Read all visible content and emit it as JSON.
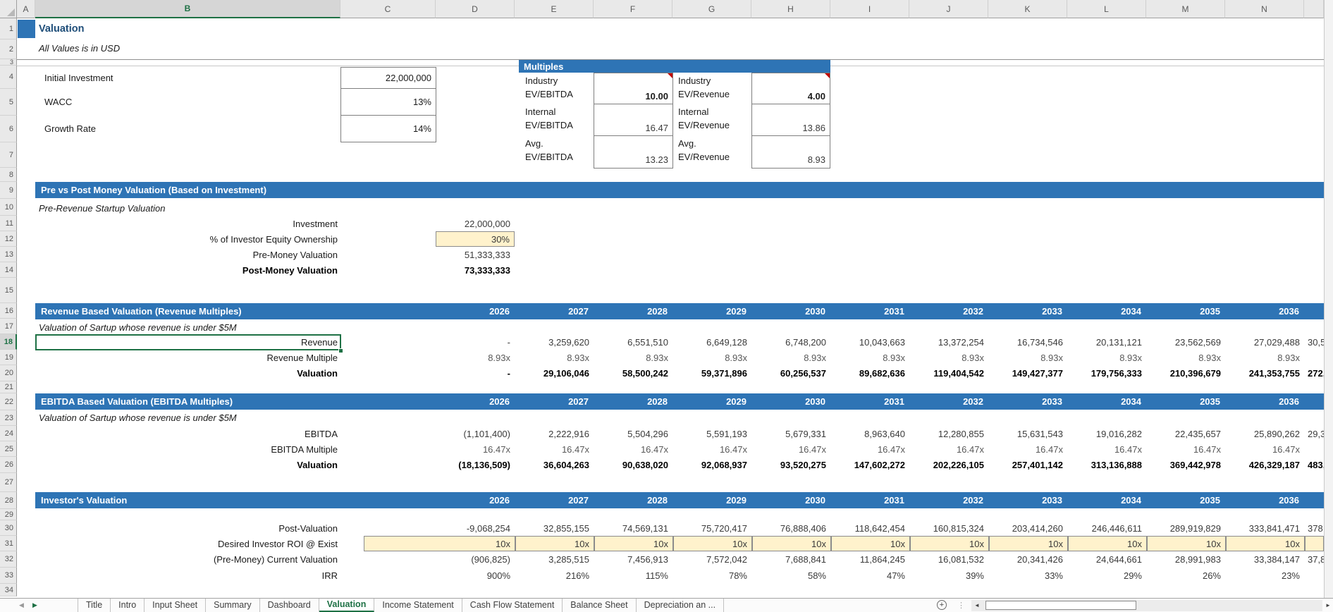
{
  "spreadsheet": {
    "column_letters": [
      "A",
      "B",
      "C",
      "D",
      "E",
      "F",
      "G",
      "H",
      "I",
      "J",
      "K",
      "L",
      "M",
      "N"
    ],
    "selected_column": "B",
    "row_numbers": [
      "1",
      "2",
      "3",
      "4",
      "5",
      "6",
      "7",
      "8",
      "9",
      "10",
      "11",
      "12",
      "13",
      "14",
      "15",
      "16",
      "17",
      "18",
      "19",
      "20",
      "21",
      "22",
      "23",
      "24",
      "25",
      "26",
      "27",
      "28",
      "29",
      "30",
      "31",
      "32",
      "33",
      "34"
    ],
    "selected_row": "18",
    "selected_cell": "B18"
  },
  "title": {
    "heading": "Valuation",
    "subtitle": "All Values is in USD"
  },
  "assumptions": [
    {
      "label": "Initial Investment",
      "value": "22,000,000"
    },
    {
      "label": "WACC",
      "value": "13%"
    },
    {
      "label": "Growth Rate",
      "value": "14%"
    }
  ],
  "multiples": {
    "header": "Multiples",
    "rows": [
      {
        "left_name": "Industry",
        "left_metric": "EV/EBITDA",
        "left_value": "10.00",
        "left_input": true,
        "right_name": "Industry",
        "right_metric": "EV/Revenue",
        "right_value": "4.00",
        "right_input": true
      },
      {
        "left_name": "Internal",
        "left_metric": "EV/EBITDA",
        "left_value": "16.47",
        "left_input": false,
        "right_name": "Internal",
        "right_metric": "EV/Revenue",
        "right_value": "13.86",
        "right_input": false
      },
      {
        "left_name": "Avg.",
        "left_metric": "EV/EBITDA",
        "left_value": "13.23",
        "left_input": false,
        "right_name": "Avg.",
        "right_metric": "EV/Revenue",
        "right_value": "8.93",
        "right_input": false
      }
    ]
  },
  "pre_post": {
    "header": "Pre vs Post Money Valuation (Based on Investment)",
    "note": "Pre-Revenue Startup Valuation",
    "rows": [
      {
        "label": "Investment",
        "value": "22,000,000",
        "input": false,
        "emphasis": "normal"
      },
      {
        "label": "% of Investor Equity Ownership",
        "value": "30%",
        "input": true,
        "emphasis": "normal"
      },
      {
        "label": "Pre-Money Valuation",
        "value": "51,333,333",
        "input": false,
        "emphasis": "normal"
      },
      {
        "label": "Post-Money Valuation",
        "value": "73,333,333",
        "input": false,
        "emphasis": "bold"
      }
    ]
  },
  "years": [
    "2026",
    "2027",
    "2028",
    "2029",
    "2030",
    "2031",
    "2032",
    "2033",
    "2034",
    "2035",
    "2036"
  ],
  "sections": [
    {
      "header": "Revenue Based Valuation (Revenue Multiples)",
      "note": "Valuation of Sartup whose revenue is under $5M",
      "rows": [
        {
          "label": "Revenue",
          "emphasis": "normal",
          "input_row": false,
          "partial": "30,5",
          "values": [
            "-",
            "3,259,620",
            "6,551,510",
            "6,649,128",
            "6,748,200",
            "10,043,663",
            "13,372,254",
            "16,734,546",
            "20,131,121",
            "23,562,569",
            "27,029,488"
          ]
        },
        {
          "label": "Revenue Multiple",
          "emphasis": "muted",
          "input_row": false,
          "partial": "",
          "values": [
            "8.93x",
            "8.93x",
            "8.93x",
            "8.93x",
            "8.93x",
            "8.93x",
            "8.93x",
            "8.93x",
            "8.93x",
            "8.93x",
            "8.93x"
          ]
        },
        {
          "label": "Valuation",
          "emphasis": "bold",
          "input_row": false,
          "partial": "272,0",
          "values": [
            "-",
            "29,106,046",
            "58,500,242",
            "59,371,896",
            "60,256,537",
            "89,682,636",
            "119,404,542",
            "149,427,377",
            "179,756,333",
            "210,396,679",
            "241,353,755"
          ]
        }
      ]
    },
    {
      "header": "EBITDA Based Valuation (EBITDA Multiples)",
      "note": "Valuation of Sartup whose revenue is under $5M",
      "rows": [
        {
          "label": "EBITDA",
          "emphasis": "normal",
          "input_row": false,
          "partial": "29,3",
          "values": [
            "(1,101,400)",
            "2,222,916",
            "5,504,296",
            "5,591,193",
            "5,679,331",
            "8,963,640",
            "12,280,855",
            "15,631,543",
            "19,016,282",
            "22,435,657",
            "25,890,262"
          ]
        },
        {
          "label": "EBITDA Multiple",
          "emphasis": "muted",
          "input_row": false,
          "partial": "",
          "values": [
            "16.47x",
            "16.47x",
            "16.47x",
            "16.47x",
            "16.47x",
            "16.47x",
            "16.47x",
            "16.47x",
            "16.47x",
            "16.47x",
            "16.47x"
          ]
        },
        {
          "label": "Valuation",
          "emphasis": "bold",
          "input_row": false,
          "partial": "483,8",
          "values": [
            "(18,136,509)",
            "36,604,263",
            "90,638,020",
            "92,068,937",
            "93,520,275",
            "147,602,272",
            "202,226,105",
            "257,401,142",
            "313,136,888",
            "369,442,978",
            "426,329,187"
          ]
        }
      ]
    },
    {
      "header": "Investor's Valuation",
      "note": "",
      "rows": [
        {
          "label": "Post-Valuation",
          "emphasis": "normal",
          "input_row": false,
          "partial": "378",
          "values": [
            "-9,068,254",
            "32,855,155",
            "74,569,131",
            "75,720,417",
            "76,888,406",
            "118,642,454",
            "160,815,324",
            "203,414,260",
            "246,446,611",
            "289,919,829",
            "333,841,471"
          ]
        },
        {
          "label": "Desired Investor ROI @ Exist",
          "emphasis": "normal",
          "input_row": true,
          "partial": "",
          "values": [
            "10x",
            "10x",
            "10x",
            "10x",
            "10x",
            "10x",
            "10x",
            "10x",
            "10x",
            "10x",
            "10x"
          ]
        },
        {
          "label": "(Pre-Money) Current Valuation",
          "emphasis": "normal",
          "input_row": false,
          "partial": "37,8",
          "values": [
            "(906,825)",
            "3,285,515",
            "7,456,913",
            "7,572,042",
            "7,688,841",
            "11,864,245",
            "16,081,532",
            "20,341,426",
            "24,644,661",
            "28,991,983",
            "33,384,147"
          ]
        },
        {
          "label": "IRR",
          "emphasis": "normal",
          "input_row": false,
          "partial": "",
          "values": [
            "900%",
            "216%",
            "115%",
            "78%",
            "58%",
            "47%",
            "39%",
            "33%",
            "29%",
            "26%",
            "23%"
          ]
        }
      ]
    }
  ],
  "tabbar": {
    "tabs": [
      "Title",
      "Intro",
      "Input Sheet",
      "Summary",
      "Dashboard",
      "Valuation",
      "Income Statement",
      "Cash Flow Statement",
      "Balance Sheet",
      "Depreciation an ..."
    ],
    "active_tab": "Valuation",
    "add_sheet_label": "+",
    "nav_left": "◀",
    "nav_right": "▶",
    "scroll_left": "◄",
    "scroll_right": "►",
    "splitter": "⋮"
  },
  "colors": {
    "accent_blue": "#2E74B5",
    "title_blue": "#1F4E79",
    "input_fill": "#FFF2CC",
    "active_tab_green": "#1E7145",
    "comment_red": "#C00000"
  }
}
